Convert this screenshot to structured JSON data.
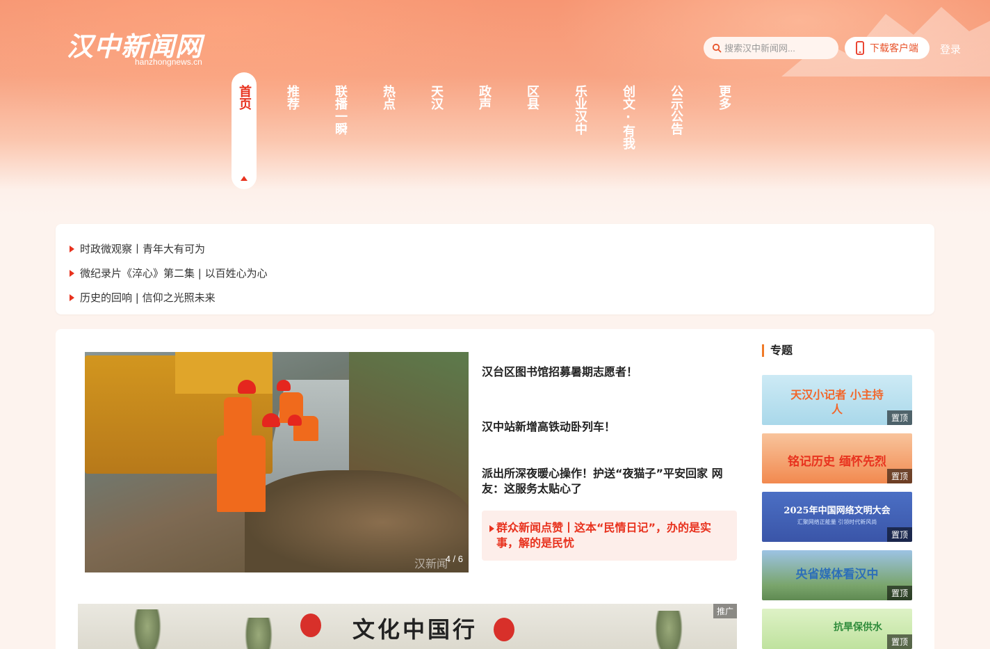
{
  "colors": {
    "accent": "#e8321e",
    "orange": "#f07a28",
    "bg": "#fdf3ee"
  },
  "header": {
    "logo_text": "汉中新闻网",
    "logo_domain": "hanzhongnews.cn",
    "search_placeholder": "搜索汉中新闻网...",
    "download_label": "下载客户端",
    "login_label": "登录"
  },
  "nav": {
    "items": [
      {
        "label": "首页",
        "active": true
      },
      {
        "label": "推荐"
      },
      {
        "label": "联播一瞬"
      },
      {
        "label": "热点"
      },
      {
        "label": "天汉"
      },
      {
        "label": "政声"
      },
      {
        "label": "区县"
      },
      {
        "label": "乐业汉中"
      },
      {
        "label": "创文·有我"
      },
      {
        "label": "公示公告"
      },
      {
        "label": "更多"
      }
    ]
  },
  "headlines": [
    "时政微观察丨青年大有可为",
    "微纪录片《淬心》第二集 | 以百姓心为心",
    "历史的回响 | 信仰之光照未来"
  ],
  "slider": {
    "counter": "4 / 6",
    "watermark": "汉新闻",
    "news": [
      "汉台区图书馆招募暑期志愿者！",
      "汉中站新增高铁动卧列车！",
      "派出所深夜暖心操作！护送“夜猫子”平安回家 网友：这服务太贴心了",
      "群众新闻点赞丨这本“民情日记”，办的是实事，解的是民忧"
    ]
  },
  "banner": {
    "title": "文化中国行",
    "tag": "推广"
  },
  "topics": {
    "title": "专题",
    "pin_label": "置顶",
    "items": [
      {
        "text": "天汉小记者 小主持人",
        "bg": "#bfe4f2"
      },
      {
        "text": "铭记历史 缅怀先烈",
        "bg": "#f4a56f"
      },
      {
        "text": "2025年中国网络文明大会",
        "sub": "汇聚网络正能量 引领时代新风尚",
        "bg": "#3f5fb6"
      },
      {
        "text": "央省媒体看汉中",
        "bg": "#8fb6d9"
      },
      {
        "text": "抗旱保供水",
        "bg": "#cfe9b3"
      }
    ]
  }
}
